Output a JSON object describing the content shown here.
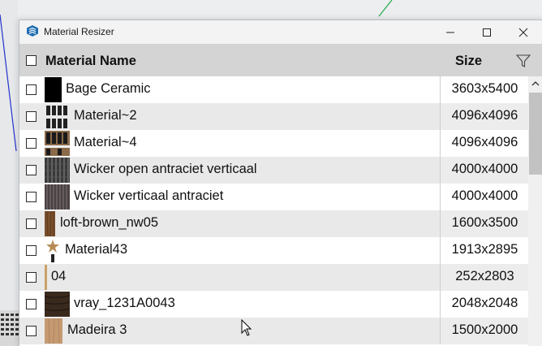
{
  "window": {
    "title": "Material Resizer",
    "controls": {
      "minimize": "–",
      "maximize": "☐",
      "close": "✕"
    }
  },
  "header": {
    "name_label": "Material Name",
    "size_label": "Size"
  },
  "rows": [
    {
      "name": "Bage Ceramic",
      "size": "3603x5400",
      "thumb": "black-swatch"
    },
    {
      "name": "Material~2",
      "size": "4096x4096",
      "thumb": "pattern-swatch"
    },
    {
      "name": "Material~4",
      "size": "4096x4096",
      "thumb": "pattern-swatch"
    },
    {
      "name": "Wicker open antraciet verticaal",
      "size": "4000x4000",
      "thumb": "wicker-swatch"
    },
    {
      "name": "Wicker verticaal antraciet",
      "size": "4000x4000",
      "thumb": "wicker-swatch"
    },
    {
      "name": "loft-brown_nw05",
      "size": "1600x3500",
      "thumb": "wood-swatch"
    },
    {
      "name": "Material43",
      "size": "1913x2895",
      "thumb": "star-swatch"
    },
    {
      "name": "04",
      "size": "252x2803",
      "thumb": "thin-wood-swatch"
    },
    {
      "name": "vray_1231A0043",
      "size": "2048x2048",
      "thumb": "dark-wood-swatch"
    },
    {
      "name": "Madeira 3",
      "size": "1500x2000",
      "thumb": "light-wood-swatch"
    }
  ],
  "icons": {
    "app": "sketchup-icon",
    "filter": "filter-icon",
    "scroll_up": "chevron-up-icon",
    "cursor": "mouse-cursor-icon"
  },
  "colors": {
    "header_bg": "#d4d4d4",
    "row_alt_bg": "#e9e9e9",
    "titlebar_bg": "#f3f3f3"
  }
}
